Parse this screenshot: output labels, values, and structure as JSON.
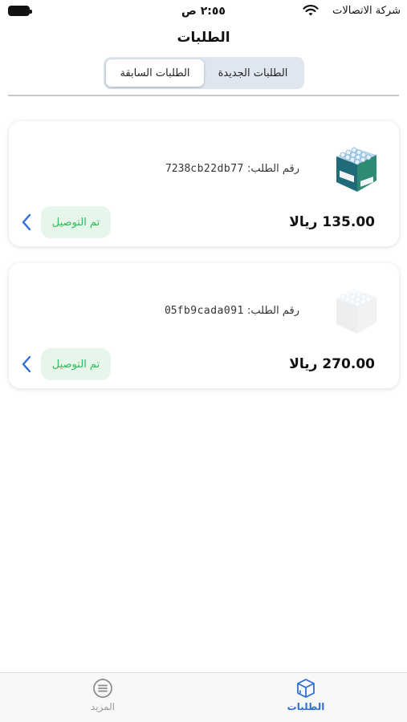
{
  "status_bar": {
    "time": "٢:٥٥ ص",
    "carrier": "شركة الاتصالات"
  },
  "page_title": "الطلبات",
  "segments": [
    {
      "label": "الطلبات الجديدة",
      "active": false
    },
    {
      "label": "الطلبات السابقة",
      "active": true
    }
  ],
  "orders": [
    {
      "order_label": "رقم الطلب:",
      "order_id": "7238cb22db77",
      "price": "135.00 ريالا",
      "status": "تم التوصيل",
      "image": "water-bottle-pack"
    },
    {
      "order_label": "رقم الطلب:",
      "order_id": "05fb9cada091",
      "price": "270.00 ريالا",
      "status": "تم التوصيل",
      "image": "water-bottle-pack-faded"
    }
  ],
  "tab_bar": {
    "tabs": [
      {
        "label": "الطلبات",
        "icon": "box-icon",
        "active": true
      },
      {
        "label": "المزيد",
        "icon": "menu-circle-icon",
        "active": false
      }
    ]
  },
  "colors": {
    "accent": "#2f6fd6",
    "status_green": "#2dbe57",
    "status_green_bg": "#e6f6ea",
    "segment_bg": "#dfe6ef"
  }
}
